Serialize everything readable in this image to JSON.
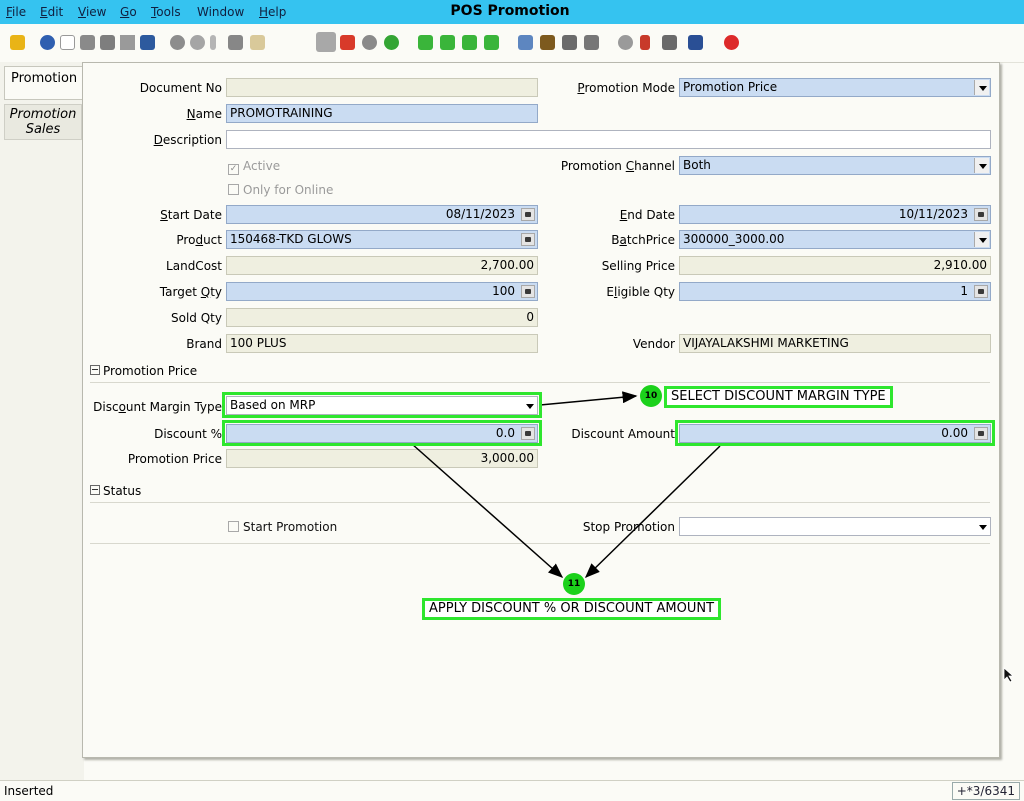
{
  "window": {
    "title": "POS Promotion"
  },
  "menu": {
    "items": [
      {
        "first": "F",
        "rest": "ile"
      },
      {
        "first": "E",
        "rest": "dit"
      },
      {
        "first": "V",
        "rest": "iew"
      },
      {
        "first": "G",
        "rest": "o"
      },
      {
        "first": "T",
        "rest": "ools"
      },
      {
        "first": "",
        "rest": "Window"
      },
      {
        "first": "H",
        "rest": "elp"
      }
    ]
  },
  "tabs": {
    "active": "Promotion",
    "other": "Promotion Sales"
  },
  "form": {
    "document_no": {
      "label": "Document No",
      "value": ""
    },
    "promotion_mode": {
      "label_pre": "",
      "label_u": "P",
      "label_post": "romotion Mode",
      "value": "Promotion Price"
    },
    "name": {
      "label_u": "N",
      "label_post": "ame",
      "value": "PROMOTRAINING"
    },
    "description": {
      "label_u": "D",
      "label_post": "escription",
      "value": ""
    },
    "active": {
      "label": "Active",
      "checked": true
    },
    "only_online": {
      "label": "Only for Online",
      "checked": false
    },
    "promotion_channel": {
      "label_pre": "Promotion ",
      "label_u": "C",
      "label_post": "hannel",
      "value": "Both"
    },
    "start_date": {
      "label_u": "S",
      "label_post": "tart Date",
      "value": "08/11/2023"
    },
    "end_date": {
      "label_u": "E",
      "label_post": "nd Date",
      "value": "10/11/2023"
    },
    "product": {
      "label_pre": "Pro",
      "label_u": "d",
      "label_post": "uct",
      "value": "150468-TKD GLOWS"
    },
    "batch_price": {
      "label_pre": "B",
      "label_u": "a",
      "label_post": "tchPrice",
      "value": "300000_3000.00"
    },
    "land_cost": {
      "label": "LandCost",
      "value": "2,700.00"
    },
    "selling_price": {
      "label": "Selling Price",
      "value": "2,910.00"
    },
    "target_qty": {
      "label_pre": "Target ",
      "label_u": "Q",
      "label_post": "ty",
      "value": "100"
    },
    "eligible_qty": {
      "label_pre": "E",
      "label_u": "l",
      "label_post": "igible Qty",
      "value": "1"
    },
    "sold_qty": {
      "label": "Sold Qty",
      "value": "0"
    },
    "brand": {
      "label": "Brand",
      "value": "100 PLUS"
    },
    "vendor": {
      "label": "Vendor",
      "value": "VIJAYALAKSHMI MARKETING"
    }
  },
  "sections": {
    "promotion_price": "Promotion Price",
    "status": "Status"
  },
  "pricing": {
    "discount_margin_type": {
      "label_pre": "Disc",
      "label_u": "o",
      "label_post": "unt Margin Type",
      "value": "Based on MRP"
    },
    "discount_pct": {
      "label": "Discount %",
      "value": "0.0"
    },
    "discount_amount": {
      "label": "Discount Amount",
      "value": "0.00"
    },
    "promotion_price": {
      "label": "Promotion Price",
      "value": "3,000.00"
    }
  },
  "status": {
    "start_promotion": {
      "label": "Start Promotion",
      "checked": false
    },
    "stop_promotion": {
      "label": "Stop Promotion",
      "value": ""
    }
  },
  "annotations": {
    "step10": {
      "number": "10",
      "text": "SELECT DISCOUNT MARGIN TYPE"
    },
    "step11": {
      "number": "11",
      "text": "APPLY DISCOUNT % OR DISCOUNT AMOUNT"
    },
    "highlight_color": "#2ee62e"
  },
  "statusbar": {
    "text": "Inserted",
    "record_info": "+*3/6341"
  },
  "toolbar_icons": [
    "undo-icon",
    "help-icon",
    "new-icon",
    "copy-icon",
    "delete-icon",
    "delete-selection-icon",
    "save-icon",
    "refresh-icon",
    "find-icon",
    "attachment-icon",
    "chat-icon",
    "grid-toggle-icon",
    "history-icon",
    "home-icon",
    "previous-icon",
    "next-icon",
    "first-record-icon",
    "previous-record-icon",
    "next-record-icon",
    "last-record-icon",
    "report-icon",
    "archive-icon",
    "print-icon",
    "print-preview-icon",
    "zoom-across-icon",
    "workflow-icon",
    "product-info-icon",
    "window-close-icon",
    "exit-icon"
  ]
}
